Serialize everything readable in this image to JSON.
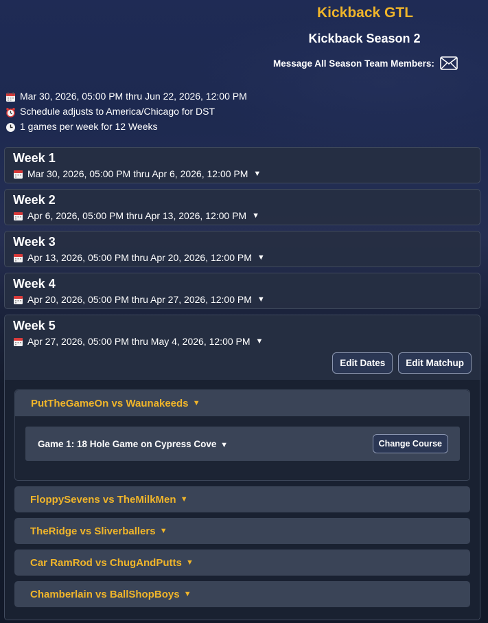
{
  "league": {
    "title": "Kickback GTL"
  },
  "season": {
    "title": "Kickback Season 2",
    "message_label": "Message All Season Team Members:"
  },
  "info": {
    "date_range": "Mar 30, 2026, 05:00 PM thru Jun 22, 2026, 12:00 PM",
    "dst": "Schedule adjusts to America/Chicago for DST",
    "frequency": "1 games per week for 12 Weeks"
  },
  "weeks": [
    {
      "title": "Week 1",
      "dates": "Mar 30, 2026, 05:00 PM thru Apr 6, 2026, 12:00 PM"
    },
    {
      "title": "Week 2",
      "dates": "Apr 6, 2026, 05:00 PM thru Apr 13, 2026, 12:00 PM"
    },
    {
      "title": "Week 3",
      "dates": "Apr 13, 2026, 05:00 PM thru Apr 20, 2026, 12:00 PM"
    },
    {
      "title": "Week 4",
      "dates": "Apr 20, 2026, 05:00 PM thru Apr 27, 2026, 12:00 PM"
    },
    {
      "title": "Week 5",
      "dates": "Apr 27, 2026, 05:00 PM thru May 4, 2026, 12:00 PM"
    }
  ],
  "week5": {
    "edit_dates_label": "Edit Dates",
    "edit_matchup_label": "Edit Matchup",
    "matchups": [
      "PutTheGameOn vs Waunakeeds",
      "FloppySevens vs TheMilkMen",
      "TheRidge vs Sliverballers",
      "Car RamRod vs ChugAndPutts",
      "Chamberlain vs BallShopBoys"
    ],
    "game": {
      "label": "Game 1: 18 Hole Game on Cypress Cove",
      "change_course_label": "Change Course"
    }
  },
  "caret": "▼",
  "colors": {
    "accent": "#f0b52a",
    "card": "#262f42",
    "matchup": "#3a4457"
  },
  "icons": {
    "calendar": "calendar-icon",
    "alarm": "alarm-clock-icon",
    "clock": "clock-icon",
    "mail": "mail-icon"
  }
}
